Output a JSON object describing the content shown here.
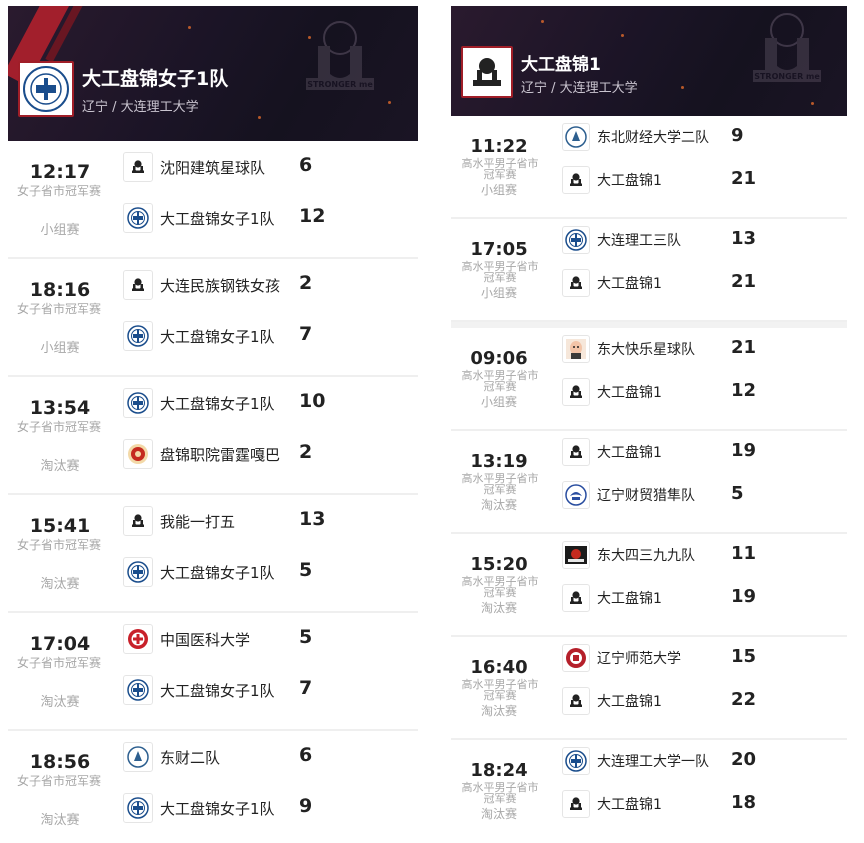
{
  "left": {
    "team_name": "大工盘锦女子1队",
    "location": "辽宁 / 大连理工大学",
    "matches": [
      {
        "time": "12:17",
        "event": "女子省市冠军赛",
        "stage": "小组赛",
        "a": {
          "name": "沈阳建筑星球队",
          "score": "6",
          "logo": "basketball-crest-icon"
        },
        "b": {
          "name": "大工盘锦女子1队",
          "score": "12",
          "logo": "dlut-seal-icon"
        }
      },
      {
        "time": "18:16",
        "event": "女子省市冠军赛",
        "stage": "小组赛",
        "a": {
          "name": "大连民族钢铁女孩",
          "score": "2",
          "logo": "basketball-crest-icon"
        },
        "b": {
          "name": "大工盘锦女子1队",
          "score": "7",
          "logo": "dlut-seal-icon"
        }
      },
      {
        "time": "13:54",
        "event": "女子省市冠军赛",
        "stage": "淘汰赛",
        "a": {
          "name": "大工盘锦女子1队",
          "score": "10",
          "logo": "dlut-seal-icon"
        },
        "b": {
          "name": "盘锦职院雷霆嘎巴",
          "score": "2",
          "logo": "red-emblem-icon"
        }
      },
      {
        "time": "15:41",
        "event": "女子省市冠军赛",
        "stage": "淘汰赛",
        "a": {
          "name": "我能一打五",
          "score": "13",
          "logo": "basketball-crest-icon"
        },
        "b": {
          "name": "大工盘锦女子1队",
          "score": "5",
          "logo": "dlut-seal-icon"
        }
      },
      {
        "time": "17:04",
        "event": "女子省市冠军赛",
        "stage": "淘汰赛",
        "a": {
          "name": "中国医科大学",
          "score": "5",
          "logo": "cmu-seal-icon"
        },
        "b": {
          "name": "大工盘锦女子1队",
          "score": "7",
          "logo": "dlut-seal-icon"
        }
      },
      {
        "time": "18:56",
        "event": "女子省市冠军赛",
        "stage": "淘汰赛",
        "a": {
          "name": "东财二队",
          "score": "6",
          "logo": "dufe-seal-icon"
        },
        "b": {
          "name": "大工盘锦女子1队",
          "score": "9",
          "logo": "dlut-seal-icon"
        }
      }
    ]
  },
  "right": {
    "team_name": "大工盘锦1",
    "location": "辽宁 / 大连理工大学",
    "matches": [
      {
        "time": "11:22",
        "event": "高水平男子省市冠军赛",
        "stage": "小组赛",
        "a": {
          "name": "东北财经大学二队",
          "score": "9",
          "logo": "dufe-seal-icon"
        },
        "b": {
          "name": "大工盘锦1",
          "score": "21",
          "logo": "basketball-crest-icon"
        }
      },
      {
        "time": "17:05",
        "event": "高水平男子省市冠军赛",
        "stage": "小组赛",
        "a": {
          "name": "大连理工三队",
          "score": "13",
          "logo": "dlut-seal-icon"
        },
        "b": {
          "name": "大工盘锦1",
          "score": "21",
          "logo": "basketball-crest-icon"
        }
      },
      {
        "time": "09:06",
        "event": "高水平男子省市冠军赛",
        "stage": "小组赛",
        "a": {
          "name": "东大快乐星球队",
          "score": "21",
          "logo": "cartoon-avatar-icon"
        },
        "b": {
          "name": "大工盘锦1",
          "score": "12",
          "logo": "basketball-crest-icon"
        }
      },
      {
        "time": "13:19",
        "event": "高水平男子省市冠军赛",
        "stage": "淘汰赛",
        "a": {
          "name": "大工盘锦1",
          "score": "19",
          "logo": "basketball-crest-icon"
        },
        "b": {
          "name": "辽宁财贸猎隼队",
          "score": "5",
          "logo": "blue-emblem-icon"
        }
      },
      {
        "time": "15:20",
        "event": "高水平男子省市冠军赛",
        "stage": "淘汰赛",
        "a": {
          "name": "东大四三九九队",
          "score": "11",
          "logo": "dark-badge-icon"
        },
        "b": {
          "name": "大工盘锦1",
          "score": "19",
          "logo": "basketball-crest-icon"
        }
      },
      {
        "time": "16:40",
        "event": "高水平男子省市冠军赛",
        "stage": "淘汰赛",
        "a": {
          "name": "辽宁师范大学",
          "score": "15",
          "logo": "lnnu-seal-icon"
        },
        "b": {
          "name": "大工盘锦1",
          "score": "22",
          "logo": "basketball-crest-icon"
        }
      },
      {
        "time": "18:24",
        "event": "高水平男子省市冠军赛",
        "stage": "淘汰赛",
        "a": {
          "name": "大连理工大学一队",
          "score": "20",
          "logo": "dlut-seal-icon"
        },
        "b": {
          "name": "大工盘锦1",
          "score": "18",
          "logo": "basketball-crest-icon"
        }
      }
    ]
  },
  "colors": {
    "header_bg": "#1b1426",
    "accent_red": "#b0202c",
    "muted_text": "#a7a7a7",
    "divider": "#efefef"
  },
  "watermark_text": "STRONGER me"
}
